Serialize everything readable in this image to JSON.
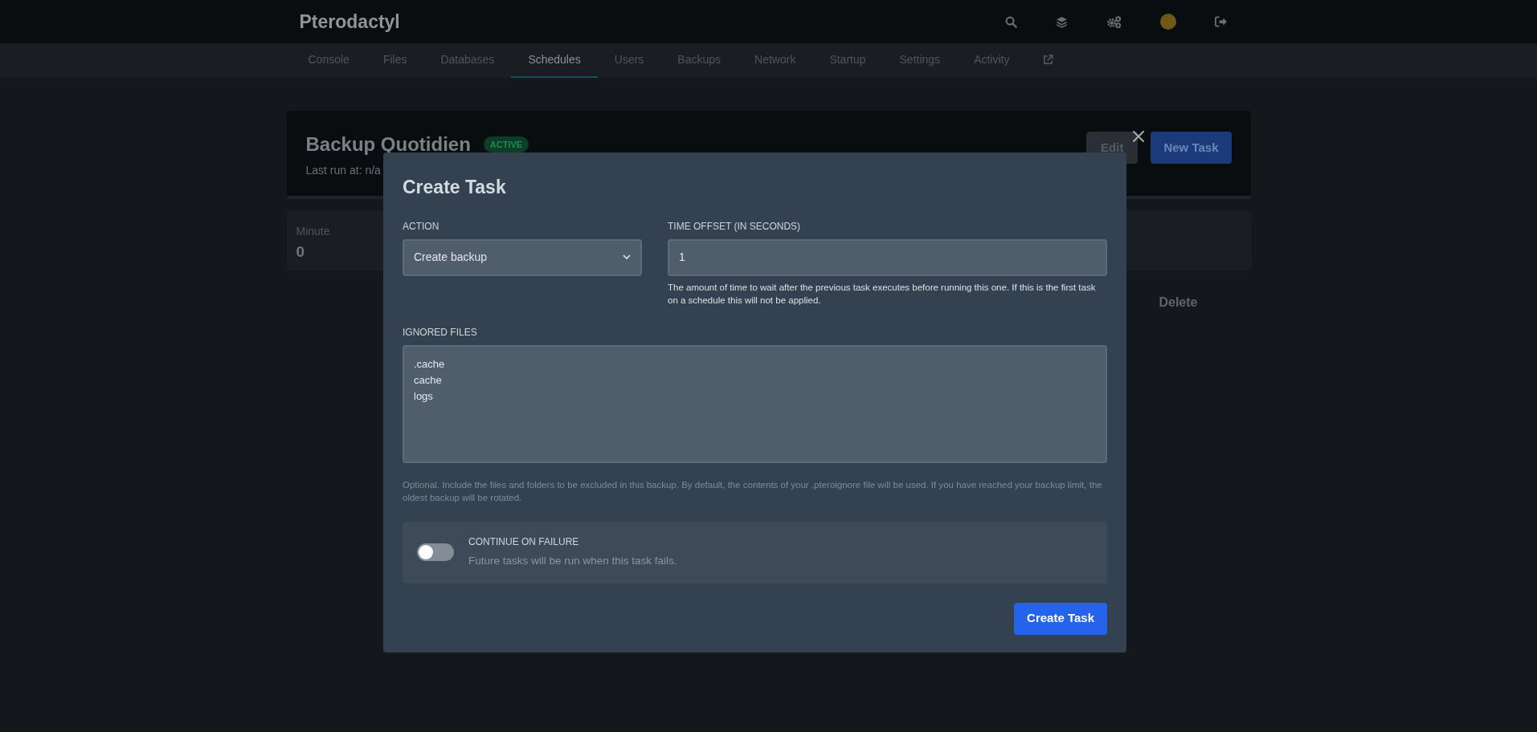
{
  "header": {
    "logo": "Pterodactyl"
  },
  "nav_tabs": [
    {
      "label": "Console",
      "selected": false
    },
    {
      "label": "Files",
      "selected": false
    },
    {
      "label": "Databases",
      "selected": false
    },
    {
      "label": "Schedules",
      "selected": true
    },
    {
      "label": "Users",
      "selected": false
    },
    {
      "label": "Backups",
      "selected": false
    },
    {
      "label": "Network",
      "selected": false
    },
    {
      "label": "Startup",
      "selected": false
    },
    {
      "label": "Settings",
      "selected": false
    },
    {
      "label": "Activity",
      "selected": false
    }
  ],
  "schedule": {
    "title": "Backup Quotidien",
    "status": "ACTIVE",
    "last_run": "Last run at: n/a",
    "buttons": [
      "Edit",
      "New Task"
    ]
  },
  "cron": [
    {
      "label": "Minute",
      "value": "0"
    }
  ],
  "task_action": "Delete",
  "modal": {
    "title": "Create Task",
    "action": {
      "label": "ACTION",
      "value": "Create backup"
    },
    "time_offset": {
      "label": "TIME OFFSET (IN SECONDS)",
      "value": "1",
      "help": "The amount of time to wait after the previous task executes before running this one. If this is the first task on a schedule this will not be applied."
    },
    "ignored_files": {
      "label": "IGNORED FILES",
      "value": ".cache\ncache\nlogs",
      "help": "Optional. Include the files and folders to be excluded in this backup. By default, the contents of your .pteroignore file will be used. If you have reached your backup limit, the oldest backup will be rotated."
    },
    "continue_on_failure": {
      "label": "CONTINUE ON FAILURE",
      "description": "Future tasks will be run when this task fails.",
      "on": false
    },
    "submit": "Create Task"
  }
}
